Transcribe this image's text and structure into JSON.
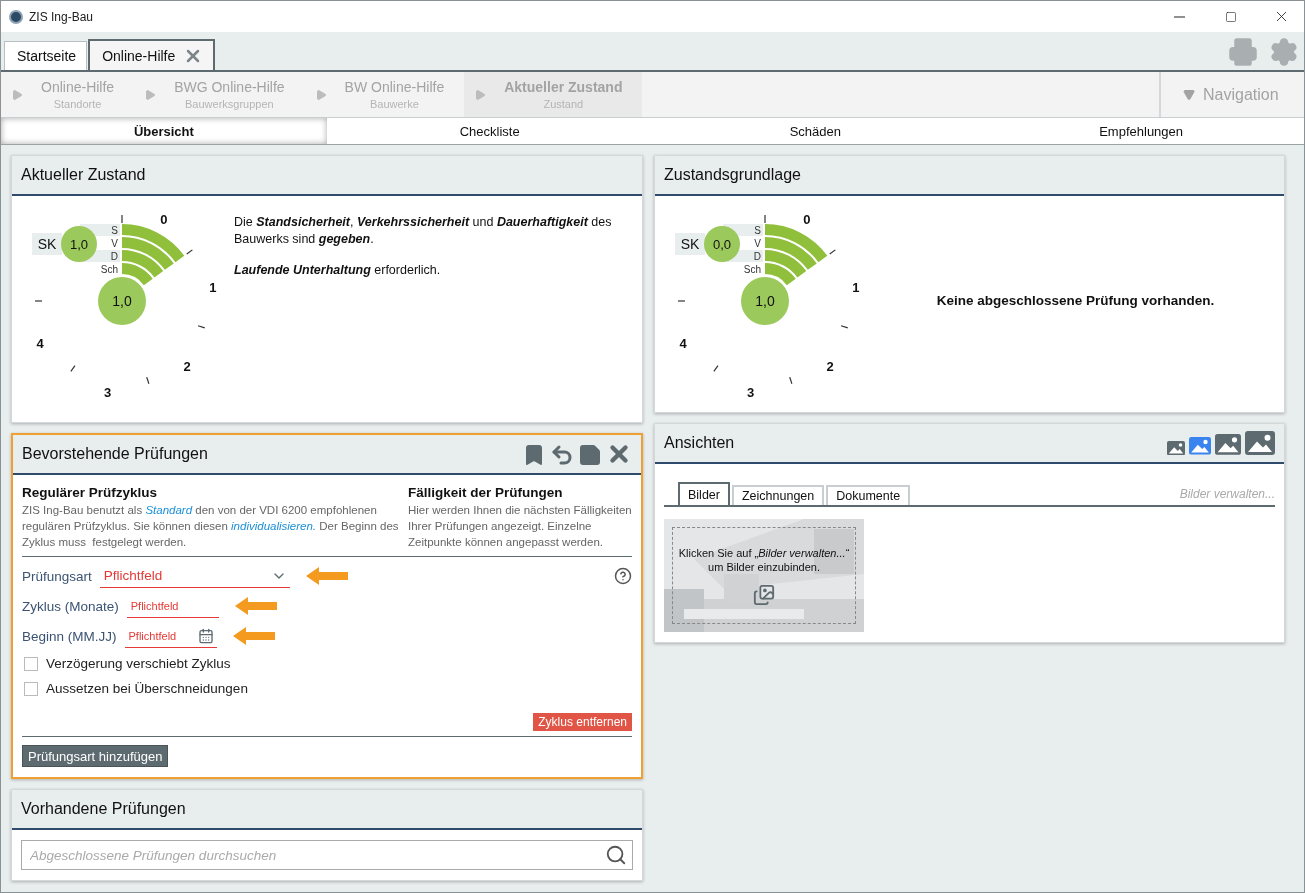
{
  "window": {
    "title": "ZIS Ing-Bau"
  },
  "tabs": [
    {
      "label": "Startseite",
      "selected": false,
      "closable": false
    },
    {
      "label": "Online-Hilfe",
      "selected": true,
      "closable": true
    }
  ],
  "breadcrumb": [
    {
      "title": "Online-Hilfe",
      "subtitle": "Standorte",
      "current": false
    },
    {
      "title": "BWG Online-Hilfe",
      "subtitle": "Bauwerksgruppen",
      "current": false
    },
    {
      "title": "BW Online-Hilfe",
      "subtitle": "Bauwerke",
      "current": false
    },
    {
      "title": "Aktueller Zustand",
      "subtitle": "Zustand",
      "current": true
    }
  ],
  "navigation": {
    "label": "Navigation"
  },
  "view_tabs": [
    {
      "label": "Übersicht",
      "selected": true
    },
    {
      "label": "Checkliste",
      "selected": false
    },
    {
      "label": "Schäden",
      "selected": false
    },
    {
      "label": "Empfehlungen",
      "selected": false
    }
  ],
  "current_condition": {
    "title": "Aktueller Zustand",
    "gauge": {
      "sk_label": "SK",
      "sk_value": "1,0",
      "main_value": "1,0",
      "rows": [
        "S",
        "V",
        "D",
        "Sch"
      ],
      "scale": [
        "0",
        "1",
        "2",
        "3",
        "4"
      ]
    },
    "paragraphs": [
      "Die **Standsicherheit**, **Verkehrssicherheit** und **Dauerhaftigkeit** des Bauwerks sind **gegeben**.",
      "**Laufende Unterhaltung** erforderlich."
    ]
  },
  "upcoming_inspections": {
    "title": "Bevorstehende Prüfungen",
    "focused": true,
    "cycle": {
      "heading": "Regulärer Prüfzyklus",
      "text": [
        {
          "text": "ZIS Ing-Bau benutzt als ",
          "kind": "plain"
        },
        {
          "text": "Standard",
          "kind": "link"
        },
        {
          "text": " den von der VDI 6200 empfohlenen regulären Prüfzyklus. Sie können diesen ",
          "kind": "plain"
        },
        {
          "text": "individualisieren.",
          "kind": "link"
        },
        {
          "text": " Der Beginn des Zyklus muss  festgelegt werden.",
          "kind": "plain"
        }
      ]
    },
    "due": {
      "heading": "Fälligkeit der Prüfungen",
      "text": "Hier werden Ihnen die nächsten Fälligkeiten Ihrer Prüfungen angezeigt. Einzelne Zeitpunkte können angepasst werden."
    },
    "fields": [
      {
        "label": "Prüfungsart",
        "placeholder": "Pflichtfeld",
        "kind": "select",
        "required": true,
        "highlighted": true
      },
      {
        "label": "Zyklus (Monate)",
        "placeholder": "Pflichtfeld",
        "kind": "text",
        "required": true,
        "highlighted": true
      },
      {
        "label": "Beginn (MM.JJ)",
        "placeholder": "Pflichtfeld",
        "kind": "date",
        "required": true,
        "highlighted": true
      }
    ],
    "checkboxes": [
      {
        "label": "Verzögerung verschiebt Zyklus",
        "checked": false
      },
      {
        "label": "Aussetzen bei Überschneidungen",
        "checked": false
      }
    ],
    "remove_button": "Zyklus entfernen",
    "add_button": "Prüfungsart hinzufügen"
  },
  "existing_inspections": {
    "title": "Vorhandene Prüfungen",
    "search": {
      "placeholder": "Abgeschlossene Prüfungen durchsuchen"
    }
  },
  "basis": {
    "title": "Zustandsgrundlage",
    "gauge": {
      "sk_label": "SK",
      "sk_value": "0,0",
      "main_value": "1,0",
      "rows": [
        "S",
        "V",
        "D",
        "Sch"
      ],
      "scale": [
        "0",
        "1",
        "2",
        "3",
        "4"
      ]
    },
    "message": "Keine abgeschlossene Prüfung vorhanden."
  },
  "views": {
    "title": "Ansichten",
    "sizes": [
      {
        "selected": false
      },
      {
        "selected": true
      },
      {
        "selected": false
      },
      {
        "selected": false
      }
    ],
    "tabs": [
      {
        "label": "Bilder",
        "selected": true
      },
      {
        "label": "Zeichnungen",
        "selected": false
      },
      {
        "label": "Dokumente",
        "selected": false
      }
    ],
    "manage_link": "Bilder verwalten...",
    "placeholder_text": "Klicken Sie auf „*Bilder verwalten...*“ um Bilder einzubinden."
  }
}
